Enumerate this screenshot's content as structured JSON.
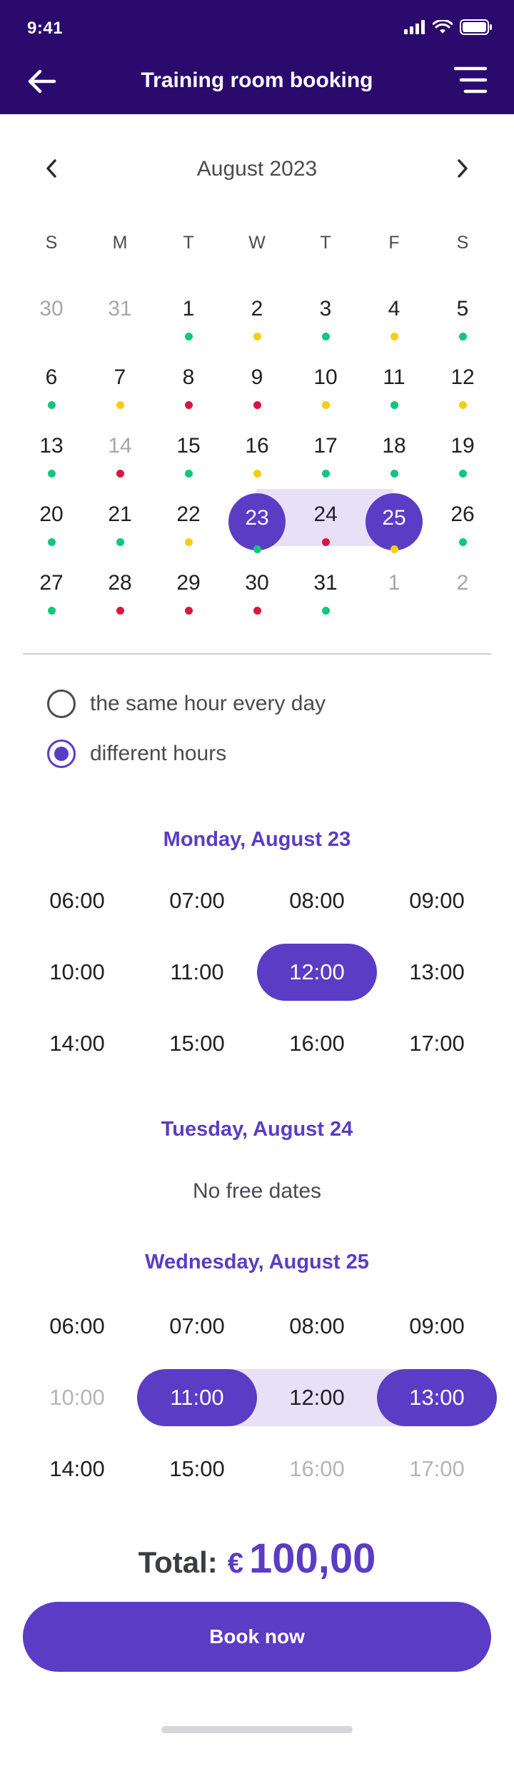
{
  "status_bar": {
    "time": "9:41"
  },
  "header": {
    "title": "Training room booking"
  },
  "calendar": {
    "month_label": "August 2023",
    "weekdays": [
      "S",
      "M",
      "T",
      "W",
      "T",
      "F",
      "S"
    ],
    "weeks": [
      [
        {
          "day": "30",
          "muted": true
        },
        {
          "day": "31",
          "muted": true
        },
        {
          "day": "1",
          "dot": "green"
        },
        {
          "day": "2",
          "dot": "yellow"
        },
        {
          "day": "3",
          "dot": "green"
        },
        {
          "day": "4",
          "dot": "yellow"
        },
        {
          "day": "5",
          "dot": "green"
        }
      ],
      [
        {
          "day": "6",
          "dot": "green"
        },
        {
          "day": "7",
          "dot": "yellow"
        },
        {
          "day": "8",
          "dot": "red"
        },
        {
          "day": "9",
          "dot": "red"
        },
        {
          "day": "10",
          "dot": "yellow"
        },
        {
          "day": "11",
          "dot": "green"
        },
        {
          "day": "12",
          "dot": "yellow"
        }
      ],
      [
        {
          "day": "13",
          "dot": "green"
        },
        {
          "day": "14",
          "muted": true,
          "dot": "red"
        },
        {
          "day": "15",
          "dot": "green"
        },
        {
          "day": "16",
          "dot": "yellow"
        },
        {
          "day": "17",
          "dot": "green"
        },
        {
          "day": "18",
          "dot": "green"
        },
        {
          "day": "19",
          "dot": "green"
        }
      ],
      [
        {
          "day": "20",
          "dot": "green"
        },
        {
          "day": "21",
          "dot": "green"
        },
        {
          "day": "22",
          "dot": "yellow"
        },
        {
          "day": "23",
          "selected": true,
          "dot": "green"
        },
        {
          "day": "24",
          "dot": "red"
        },
        {
          "day": "25",
          "selected": true,
          "dot": "yellow"
        },
        {
          "day": "26",
          "dot": "green"
        }
      ],
      [
        {
          "day": "27",
          "dot": "green"
        },
        {
          "day": "28",
          "dot": "red"
        },
        {
          "day": "29",
          "dot": "red"
        },
        {
          "day": "30",
          "dot": "red"
        },
        {
          "day": "31",
          "dot": "green"
        },
        {
          "day": "1",
          "muted": true
        },
        {
          "day": "2",
          "muted": true
        }
      ]
    ]
  },
  "colors": {
    "header_bg": "#2b0a6e",
    "accent": "#5b3cc4",
    "range_bg": "#e8e0f7",
    "dot_green": "#12c77a",
    "dot_yellow": "#f5cc16",
    "dot_red": "#d9163f"
  },
  "hour_mode": {
    "options": [
      {
        "label": "the same hour every day",
        "checked": false
      },
      {
        "label": "different hours",
        "checked": true
      }
    ]
  },
  "schedule": [
    {
      "heading": "Monday, August 23",
      "slots": [
        {
          "time": "06:00"
        },
        {
          "time": "07:00"
        },
        {
          "time": "08:00"
        },
        {
          "time": "09:00"
        },
        {
          "time": "10:00"
        },
        {
          "time": "11:00"
        },
        {
          "time": "12:00",
          "selected": true
        },
        {
          "time": "13:00"
        },
        {
          "time": "14:00"
        },
        {
          "time": "15:00"
        },
        {
          "time": "16:00"
        },
        {
          "time": "17:00"
        }
      ]
    },
    {
      "heading": "Tuesday, August 24",
      "empty_text": "No free dates"
    },
    {
      "heading": "Wednesday, August 25",
      "slots": [
        {
          "time": "06:00"
        },
        {
          "time": "07:00"
        },
        {
          "time": "08:00"
        },
        {
          "time": "09:00"
        },
        {
          "time": "10:00",
          "disabled": true
        },
        {
          "time": "11:00",
          "selected": true
        },
        {
          "time": "12:00",
          "in_range": true
        },
        {
          "time": "13:00",
          "selected": true
        },
        {
          "time": "14:00"
        },
        {
          "time": "15:00"
        },
        {
          "time": "16:00",
          "disabled": true
        },
        {
          "time": "17:00",
          "disabled": true
        }
      ]
    }
  ],
  "total": {
    "label": "Total:",
    "currency": "€",
    "amount": "100,00"
  },
  "book_button": {
    "label": "Book now"
  }
}
